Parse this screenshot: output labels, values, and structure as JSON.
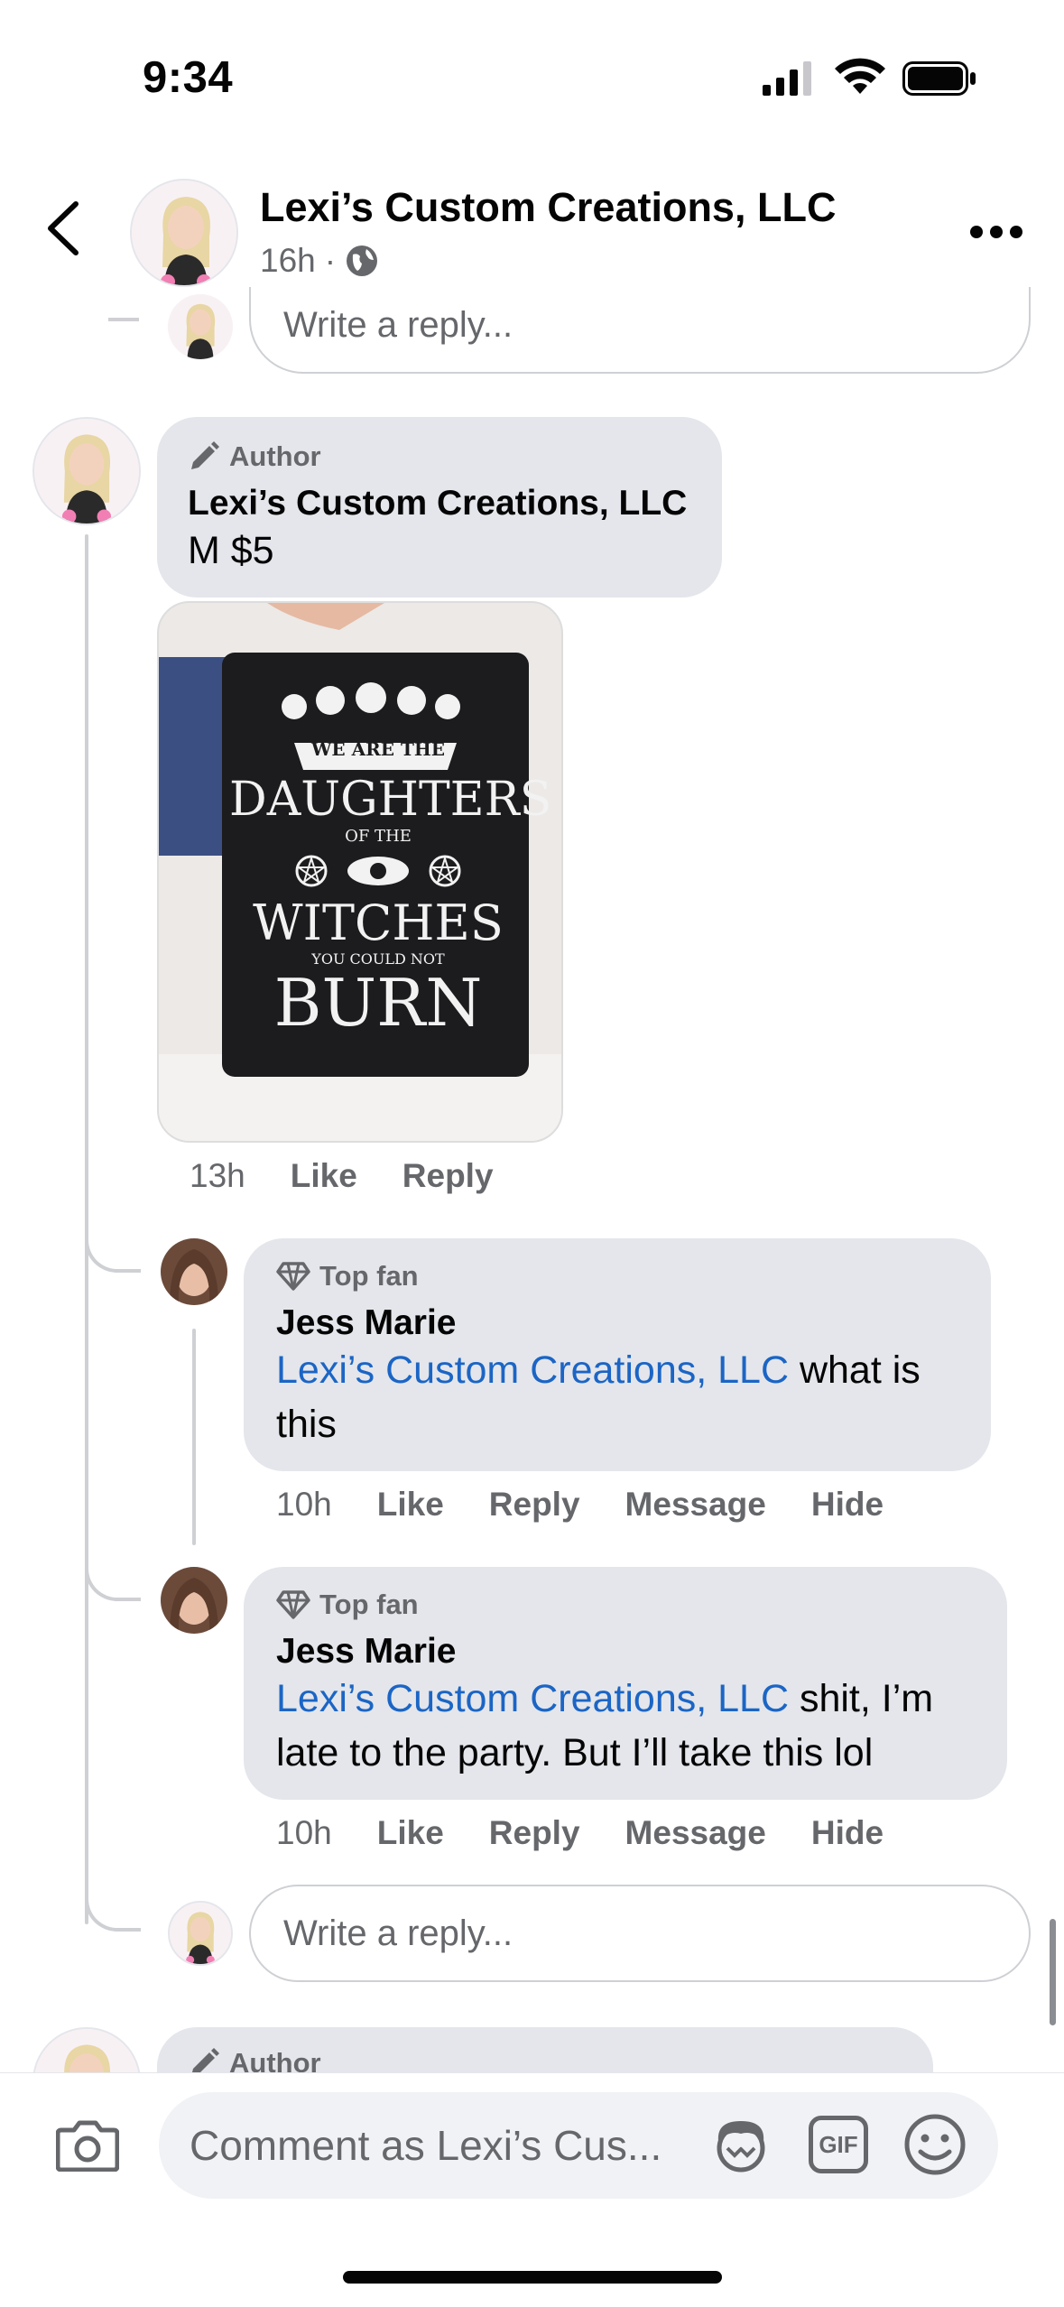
{
  "status_bar": {
    "time": "9:34"
  },
  "header": {
    "page_name": "Lexi’s Custom Creations, LLC",
    "time_ago": "16h",
    "separator": "·",
    "privacy_icon": "globe-icon"
  },
  "top_reply": {
    "placeholder": "Write a reply..."
  },
  "author_comment": {
    "badge": "Author",
    "badge_icon": "pencil-icon",
    "name": "Lexi’s Custom Creations, LLC",
    "text": "M $5",
    "image_text": [
      "WE ARE THE",
      "DAUGHTERS",
      "OF THE",
      "WITCHES",
      "YOU COULD NOT",
      "BURN"
    ],
    "time": "13h",
    "like": "Like",
    "reply": "Reply"
  },
  "replies": [
    {
      "badge": "Top fan",
      "badge_icon": "diamond-icon",
      "name": "Jess Marie",
      "mention": "Lexi’s Custom Creations, LLC",
      "text_line1": " what is",
      "text_line2": "this",
      "time": "10h",
      "like": "Like",
      "reply": "Reply",
      "message": "Message",
      "hide": "Hide"
    },
    {
      "badge": "Top fan",
      "badge_icon": "diamond-icon",
      "name": "Jess Marie",
      "mention": "Lexi’s Custom Creations, LLC",
      "text_line1": " shit, I’m",
      "text_line2": "late to the party. But I’ll take this lol",
      "time": "10h",
      "like": "Like",
      "reply": "Reply",
      "message": "Message",
      "hide": "Hide"
    }
  ],
  "bottom_reply": {
    "placeholder": "Write a reply..."
  },
  "next_comment": {
    "badge": "Author"
  },
  "composer": {
    "placeholder": "Comment as Lexi’s Cus...",
    "camera_icon": "camera-icon",
    "avatar_sticker_icon": "avatar-sticker-icon",
    "gif_label": "GIF",
    "emoji_icon": "emoji-icon"
  }
}
